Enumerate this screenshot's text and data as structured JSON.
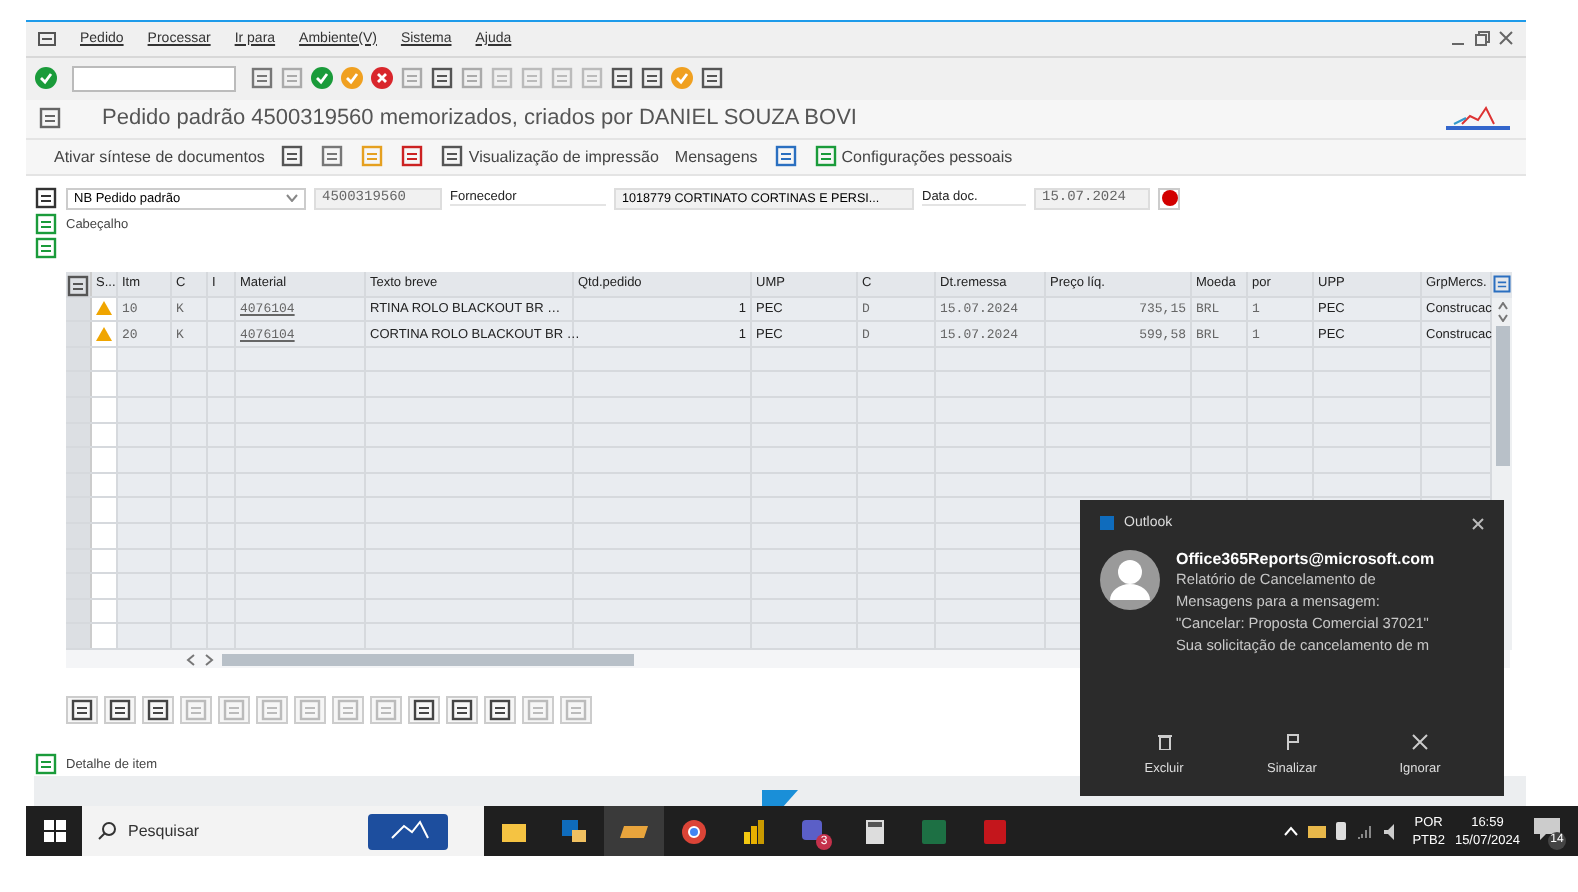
{
  "menu": [
    "Pedido",
    "Processar",
    "Ir para",
    "Ambiente(V)",
    "Sistema",
    "Ajuda"
  ],
  "title": "Pedido padrão 4500319560 memorizados, criados por DANIEL SOUZA BOVI",
  "app_toolbar": {
    "overview": "Ativar síntese de documentos",
    "print_preview": "Visualização de impressão",
    "messages": "Mensagens",
    "settings": "Configurações pessoais"
  },
  "header": {
    "doc_type": "NB Pedido padrão",
    "doc_number": "4500319560",
    "supplier_label": "Fornecedor",
    "supplier": "1018779 CORTINATO CORTINAS E PERSI...",
    "date_label": "Data doc.",
    "date": "15.07.2024",
    "section": "Cabeçalho"
  },
  "table": {
    "columns": [
      "S...",
      "Itm",
      "C",
      "I",
      "Material",
      "Texto breve",
      "Qtd.pedido",
      "UMP",
      "C",
      "Dt.remessa",
      "Preço líq.",
      "Moeda",
      "por",
      "UPP",
      "GrpMercs."
    ],
    "rows": [
      {
        "item": "10",
        "c": "K",
        "material": "4076104",
        "text": "RTINA ROLO BLACKOUT BR …",
        "qty": "1",
        "ump": "PEC",
        "c2": "D",
        "delivery": "15.07.2024",
        "price": "735,15",
        "currency": "BRL",
        "per": "1",
        "upp": "PEC",
        "group": "Construcac"
      },
      {
        "item": "20",
        "c": "K",
        "material": "4076104",
        "text": "CORTINA ROLO BLACKOUT BR …",
        "qty": "1",
        "ump": "PEC",
        "c2": "D",
        "delivery": "15.07.2024",
        "price": "599,58",
        "currency": "BRL",
        "per": "1",
        "upp": "PEC",
        "group": "Construcac"
      }
    ]
  },
  "item_detail": "Detalhe de item",
  "taskbar": {
    "search_placeholder": "Pesquisar",
    "teams_badge": "3",
    "lang": "POR",
    "layout": "PTB2",
    "time": "16:59",
    "date": "15/07/2024",
    "notifications": "14"
  },
  "notification": {
    "app": "Outlook",
    "sender": "Office365Reports@microsoft.com",
    "lines": [
      "Relatório de Cancelamento de",
      "Mensagens para a mensagem:",
      "\"Cancelar: Proposta Comercial 37021\"",
      "Sua solicitação de cancelamento de m"
    ],
    "actions": [
      "Excluir",
      "Sinalizar",
      "Ignorar"
    ]
  }
}
